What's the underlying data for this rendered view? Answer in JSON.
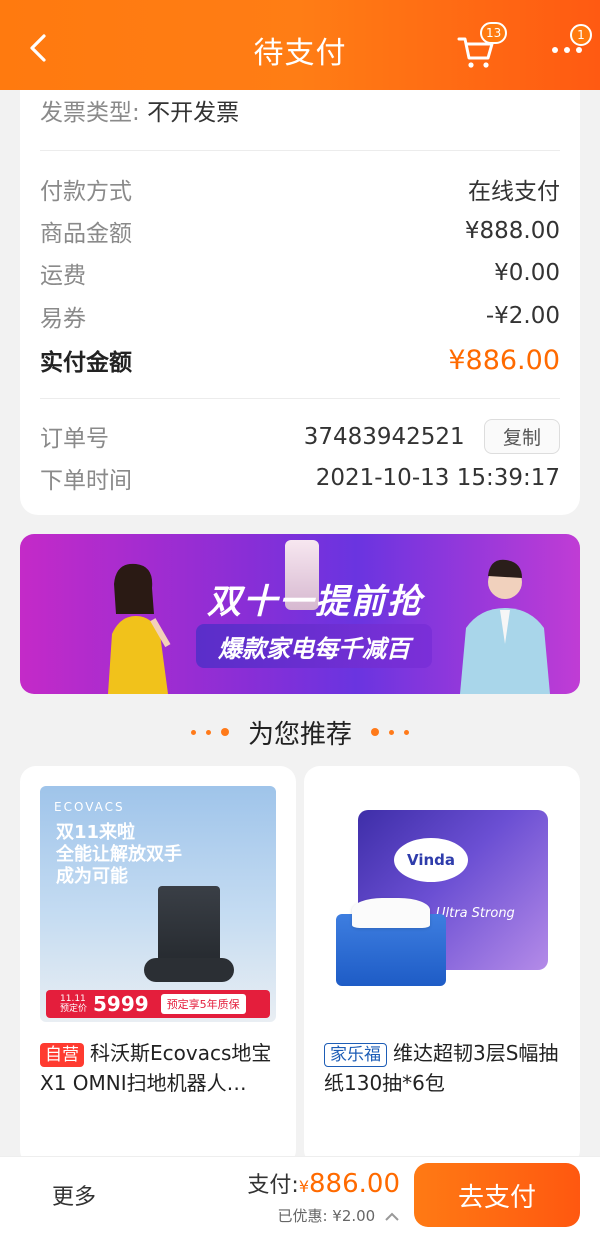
{
  "header": {
    "title": "待支付",
    "cart_badge": "13",
    "more_badge": "1"
  },
  "order": {
    "invoice_label": "发票类型:",
    "invoice_value": "不开发票",
    "payment_method_label": "付款方式",
    "payment_method_value": "在线支付",
    "goods_amount_label": "商品金额",
    "goods_amount_value": "¥888.00",
    "shipping_label": "运费",
    "shipping_value": "¥0.00",
    "coupon_label": "易券",
    "coupon_value": "-¥2.00",
    "paid_label": "实付金额",
    "paid_value": "¥886.00",
    "order_no_label": "订单号",
    "order_no_value": "37483942521",
    "copy_label": "复制",
    "order_time_label": "下单时间",
    "order_time_value": "2021-10-13  15:39:17"
  },
  "banner": {
    "headline": "双十一提前抢",
    "subline": "爆款家电每千减百"
  },
  "recommend": {
    "title": "为您推荐",
    "products": [
      {
        "tag": "自营",
        "title": "科沃斯Ecovacs地宝X1 OMNI扫地机器人…",
        "image": {
          "brand": "ECOVACS",
          "slogan1": "双11来啦",
          "slogan2": "全能让解放双手",
          "slogan3": "成为可能",
          "price_label_1": "11.11",
          "price_label_2": "预定价",
          "price": "5999",
          "warranty": "预定享5年质保"
        }
      },
      {
        "tag": "家乐福",
        "title": "维达超韧3层S幅抽纸130抽*6包",
        "image": {
          "brand": "Vinda",
          "subbrand": "Ultra Strong"
        }
      }
    ]
  },
  "bottom": {
    "more_label": "更多",
    "pay_prefix": "支付:",
    "pay_yen": "¥",
    "pay_amount": "886.00",
    "discount_text": "已优惠: ¥2.00",
    "pay_button": "去支付"
  },
  "colors": {
    "accent": "#ff7a0f",
    "price": "#ff6a00"
  }
}
